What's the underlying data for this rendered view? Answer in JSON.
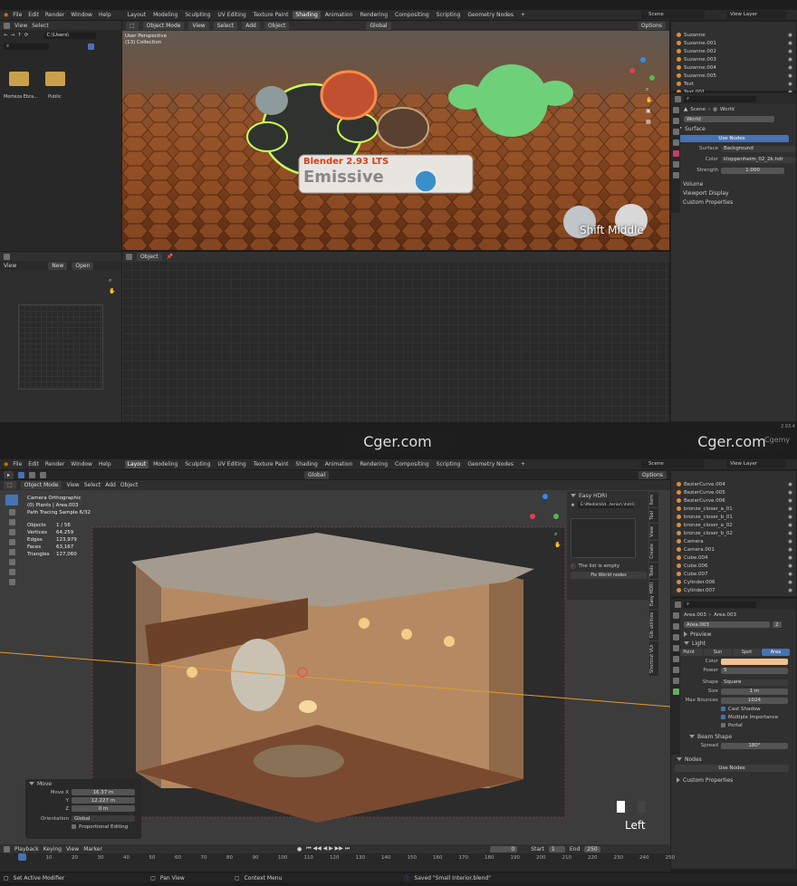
{
  "top": {
    "menu": [
      "File",
      "Edit",
      "Render",
      "Window",
      "Help"
    ],
    "workspaces": [
      "Layout",
      "Modeling",
      "Sculpting",
      "UV Editing",
      "Texture Paint",
      "Shading",
      "Animation",
      "Rendering",
      "Compositing",
      "Scripting",
      "Geometry Nodes"
    ],
    "active_workspace": "Shading",
    "scene": "Scene",
    "view_layer": "View Layer",
    "filebrowser": {
      "menu": [
        "View",
        "Select"
      ],
      "path": "C:\\Users\\",
      "items": [
        "Morteza Ebra...",
        "Public"
      ]
    },
    "viewport": {
      "mode": "Object Mode",
      "menu": [
        "View",
        "Select",
        "Add",
        "Object"
      ],
      "orientation": "Global",
      "options": "Options",
      "info1": "User Perspective",
      "info2": "(13) Collection",
      "sign_title": "Blender 2.93 LTS",
      "sign_text": "Emissive",
      "overlay": "Shift Middle"
    },
    "outliner": [
      "Suzanne",
      "Suzanne.001",
      "Suzanne.002",
      "Suzanne.003",
      "Suzanne.004",
      "Suzanne.005",
      "Text",
      "Text.001"
    ],
    "world_props": {
      "scene_tab": "Scene",
      "world_tab": "World",
      "world": "World",
      "surface_section": "Surface",
      "use_nodes": "Use Nodes",
      "surface_label": "Surface",
      "surface_value": "Background",
      "color_label": "Color",
      "color_value": "kloppenheim_02_2k.hdr",
      "strength_label": "Strength",
      "strength_value": "1.000",
      "volume": "Volume",
      "viewport_display": "Viewport Display",
      "custom_props": "Custom Properties"
    },
    "image_editor": {
      "view": "View",
      "new": "New",
      "open": "Open"
    },
    "node_editor": {
      "mode": "Object"
    },
    "version": "2.93.4"
  },
  "watermark": "Cger.com",
  "watermark_partial": "Cgemy",
  "bottom": {
    "menu": [
      "File",
      "Edit",
      "Render",
      "Window",
      "Help"
    ],
    "workspaces": [
      "Layout",
      "Modeling",
      "Sculpting",
      "UV Editing",
      "Texture Paint",
      "Shading",
      "Animation",
      "Rendering",
      "Compositing",
      "Scripting",
      "Geometry Nodes"
    ],
    "active_workspace": "Layout",
    "scene": "Scene",
    "view_layer": "View Layer",
    "viewport": {
      "mode": "Object Mode",
      "menu": [
        "View",
        "Select",
        "Add",
        "Object"
      ],
      "orientation": "Global",
      "options": "Options",
      "info": [
        "Camera Orthographic",
        "(0) Plants | Area.003",
        "Path Tracing Sample 6/32"
      ],
      "overlay": "Left"
    },
    "stats": [
      [
        "Objects",
        "1 / 56"
      ],
      [
        "Vertices",
        "64,259"
      ],
      [
        "Edges",
        "123,979"
      ],
      [
        "Faces",
        "63,167"
      ],
      [
        "Triangles",
        "127,060"
      ]
    ],
    "easy_hdri": {
      "title": "Easy HDRI",
      "path": "E:\\Media\\Vid...terior\\.\\hdri\\",
      "empty": "The list is empty",
      "fix": "Fix World nodes"
    },
    "side_tabs": [
      "Item",
      "Tool",
      "View",
      "Create",
      "Tools",
      "Easy HDRI",
      "Glb utilities",
      "Shortcut VUr"
    ],
    "outliner": [
      "BezierCurve.004",
      "BezierCurve.005",
      "BezierCurve.006",
      "bronze_closer_a_01",
      "bronze_closer_b_01",
      "bronze_closer_a_02",
      "bronze_closer_b_02",
      "Camera",
      "Camera.001",
      "Cube.004",
      "Cube.006",
      "Cube.007",
      "Cylinder.006",
      "Cylinder.007"
    ],
    "light_props": {
      "obj1": "Area.003",
      "obj2": "Area.003",
      "data": "Area.003",
      "users": "2",
      "preview": "Preview",
      "light": "Light",
      "types": [
        "Point",
        "Sun",
        "Spot",
        "Area"
      ],
      "active_type": "Area",
      "color_label": "Color",
      "power_label": "Power",
      "power_value": "5",
      "shape_label": "Shape",
      "shape_value": "Square",
      "size_label": "Size",
      "size_value": "1 m",
      "bounces_label": "Max Bounces",
      "bounces_value": "1024",
      "cast_shadow": "Cast Shadow",
      "mis": "Multiple Importance",
      "portal": "Portal",
      "beam": "Beam Shape",
      "spread_label": "Spread",
      "spread_value": "180°",
      "nodes": "Nodes",
      "use_nodes": "Use Nodes",
      "custom_props": "Custom Properties",
      "light_color": "#f4c08d"
    },
    "operator": {
      "title": "Move",
      "move_x_label": "Move X",
      "move_x": "16.37 m",
      "y_label": "Y",
      "y": "12.227 m",
      "z_label": "Z",
      "z": "0 m",
      "orient_label": "Orientation",
      "orient": "Global",
      "prop": "Proportional Editing"
    },
    "timeline": {
      "menu": [
        "Playback",
        "Keying",
        "View",
        "Marker"
      ],
      "frame": "0",
      "start_label": "Start",
      "start": "1",
      "end_label": "End",
      "end": "250",
      "ticks": [
        "0",
        "10",
        "20",
        "30",
        "40",
        "50",
        "60",
        "70",
        "80",
        "90",
        "100",
        "110",
        "120",
        "130",
        "140",
        "150",
        "160",
        "170",
        "180",
        "190",
        "200",
        "210",
        "220",
        "230",
        "240",
        "250"
      ]
    },
    "status": {
      "left": "Set Active Modifier",
      "mid1": "Pan View",
      "mid2": "Context Menu",
      "saved": "Saved \"Small Interior.blend\""
    }
  }
}
